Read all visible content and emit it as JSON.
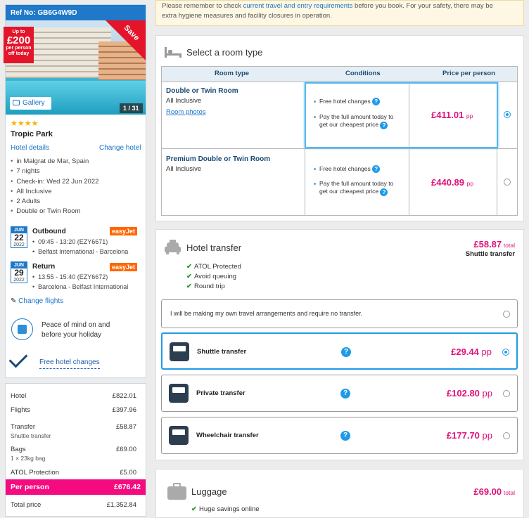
{
  "booking": {
    "ref_label": "Ref No: GB6G4W9D"
  },
  "promo": {
    "line1": "Up to",
    "amount": "£200",
    "line2": "per person",
    "line3": "off today",
    "ribbon": "Save"
  },
  "gallery": {
    "label": "Gallery",
    "counter": "1 / 31"
  },
  "hotel": {
    "stars": "★★★★",
    "name": "Tropic Park",
    "details_link": "Hotel details",
    "change_link": "Change hotel",
    "facts": [
      "in Malgrat de Mar, Spain",
      "7 nights",
      "Check-in: Wed 22 Jun 2022",
      "All Inclusive",
      "2 Adults",
      "Double or Twin Room"
    ]
  },
  "flights": {
    "outbound": {
      "month": "JUN",
      "day": "22",
      "year": "2022",
      "title": "Outbound",
      "airline": "easyJet",
      "time": "09:45 - 13:20 (EZY6671)",
      "route": "Belfast International - Barcelona"
    },
    "return": {
      "month": "JUN",
      "day": "29",
      "year": "2022",
      "title": "Return",
      "airline": "easyJet",
      "time": "13:55 - 15:40 (EZY6672)",
      "route": "Barcelona - Belfast International"
    },
    "change_link": "Change flights"
  },
  "assurance": {
    "peace_line1": "Peace of mind on and",
    "peace_line2": "before your holiday",
    "free_changes": "Free hotel changes"
  },
  "summary": {
    "hotel_label": "Hotel",
    "hotel_value": "£822.01",
    "flights_label": "Flights",
    "flights_value": "£397.96",
    "transfer_label": "Transfer",
    "transfer_value": "£58.87",
    "transfer_sub": "Shuttle transfer",
    "bags_label": "Bags",
    "bags_value": "£69.00",
    "bags_sub": "1 × 23kg bag",
    "atol_label": "ATOL Protection",
    "atol_value": "£5.00",
    "per_person_label": "Per person",
    "per_person_value": "£676.42",
    "total_label": "Total price",
    "total_value": "£1,352.84"
  },
  "notice": {
    "text_before": "Please remember to check ",
    "link": "current travel and entry requirements",
    "text_after": " before you book. For your safety, there may be",
    "line2": "extra hygiene measures and facility closures in operation."
  },
  "rooms": {
    "title": "Select a room type",
    "headers": {
      "type": "Room type",
      "conditions": "Conditions",
      "price": "Price per person"
    },
    "items": [
      {
        "name": "Double or Twin Room",
        "board": "All Inclusive",
        "photos": "Room photos",
        "cond1": "Free hotel changes",
        "cond2a": "Pay the full amount today to",
        "cond2b": "get our cheapest price",
        "price": "£411.01",
        "unit": "pp",
        "selected": true
      },
      {
        "name": "Premium Double or Twin Room",
        "board": "All Inclusive",
        "cond1": "Free hotel changes",
        "cond2a": "Pay the full amount today to",
        "cond2b": "get our cheapest price",
        "price": "£440.89",
        "unit": "pp",
        "selected": false
      }
    ]
  },
  "transfer": {
    "title": "Hotel transfer",
    "total": "£58.87",
    "total_unit": "total",
    "selected_name": "Shuttle transfer",
    "features": [
      "ATOL Protected",
      "Avoid queuing",
      "Round trip"
    ],
    "none_option": "I will be making my own travel arrangements and require no transfer.",
    "options": [
      {
        "name": "Shuttle transfer",
        "price": "£29.44",
        "unit": "pp",
        "selected": true
      },
      {
        "name": "Private transfer",
        "price": "£102.80",
        "unit": "pp",
        "selected": false
      },
      {
        "name": "Wheelchair transfer",
        "price": "£177.70",
        "unit": "pp",
        "selected": false
      }
    ]
  },
  "luggage": {
    "title": "Luggage",
    "total": "£69.00",
    "total_unit": "total",
    "feature": "Huge savings online"
  },
  "colors": {
    "brand_blue": "#1f78c8",
    "price_pink": "#e0127a",
    "highlight_pink": "#f40b7f",
    "save_red": "#e4152b",
    "easyjet_orange": "#ff6600"
  }
}
